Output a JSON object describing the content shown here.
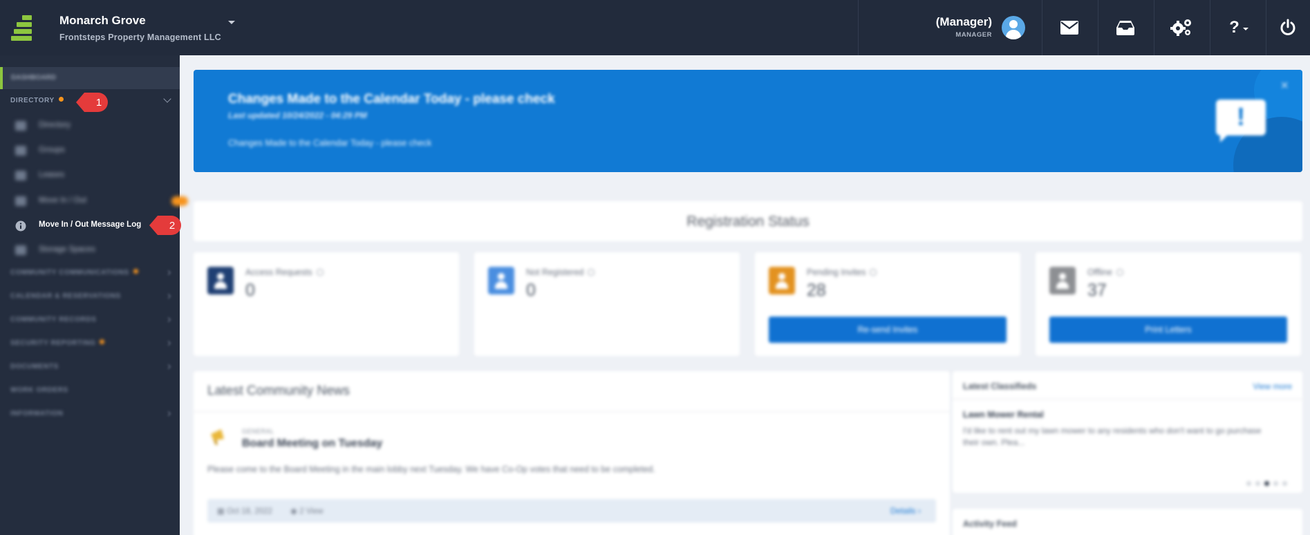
{
  "header": {
    "org_name": "Monarch Grove",
    "org_subtitle": "Frontsteps Property Management LLC",
    "user_name": "(Manager)",
    "user_role": "MANAGER",
    "icons": [
      "mail-icon",
      "inbox-icon",
      "settings-icon",
      "help-icon",
      "power-icon"
    ]
  },
  "sidebar": {
    "dashboard": "DASHBOARD",
    "directory": "DIRECTORY",
    "directory_items": [
      {
        "label": "Directory",
        "icon": "directory-icon"
      },
      {
        "label": "Groups",
        "icon": "groups-icon"
      },
      {
        "label": "Leases",
        "icon": "leases-icon"
      },
      {
        "label": "Move In / Out",
        "icon": "move-icon"
      },
      {
        "label": "Move In / Out Message Log",
        "icon": "info-icon"
      },
      {
        "label": "Storage Spaces",
        "icon": "storage-icon"
      }
    ],
    "sections": [
      "COMMUNITY COMMUNICATIONS",
      "CALENDAR & RESERVATIONS",
      "COMMUNITY RECORDS",
      "SECURITY REPORTING",
      "DOCUMENTS",
      "WORK ORDERS",
      "INFORMATION"
    ]
  },
  "callouts": {
    "one": "1",
    "two": "2"
  },
  "banner": {
    "title": "Changes Made to the Calendar Today - please check",
    "updated": "Last updated 10/24/2022 - 04:29 PM",
    "body": "Changes Made to the Calendar Today - please check",
    "close": "×",
    "icon_mark": "!"
  },
  "registration": {
    "title": "Registration Status",
    "stats": [
      {
        "label": "Access Requests",
        "value": "0",
        "color": "#1f3f73"
      },
      {
        "label": "Not Registered",
        "value": "0",
        "color": "#4a8ee0"
      },
      {
        "label": "Pending Invites",
        "value": "28",
        "color": "#e39220",
        "button": "Re-send Invites"
      },
      {
        "label": "Offline",
        "value": "37",
        "color": "#8d8f93",
        "button": "Print Letters"
      }
    ]
  },
  "news": {
    "title": "Latest Community News",
    "category": "GENERAL",
    "item_title": "Board Meeting on Tuesday",
    "item_body": "Please come to the Board Meeting in the main lobby next Tuesday. We have Co-Op votes that need to be completed.",
    "date": "Oct 18, 2022",
    "views": "2 View",
    "details": "Details"
  },
  "classifieds": {
    "title": "Latest Classifieds",
    "view_more": "View more",
    "item_title": "Lawn Mower Rental",
    "item_body": "I'd like to rent out my lawn mower to any residents who don't want to go purchase their own. Plea..."
  },
  "activity": {
    "title": "Activity Feed"
  }
}
